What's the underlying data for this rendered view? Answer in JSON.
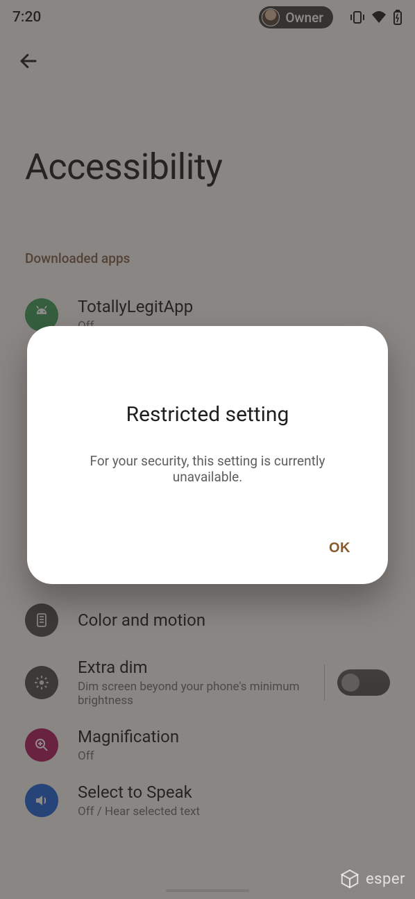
{
  "status": {
    "time": "7:20",
    "owner_label": "Owner"
  },
  "page": {
    "title": "Accessibility"
  },
  "sections": {
    "downloaded_header": "Downloaded apps"
  },
  "items": {
    "totallylegit": {
      "title": "TotallyLegitApp",
      "sub": "Off"
    },
    "colormotion": {
      "title": "Color and motion"
    },
    "extradim": {
      "title": "Extra dim",
      "sub": "Dim screen beyond your phone's minimum brightness"
    },
    "magnification": {
      "title": "Magnification",
      "sub": "Off"
    },
    "selecttospeak": {
      "title": "Select to Speak",
      "sub": "Off / Hear selected text"
    }
  },
  "dialog": {
    "title": "Restricted setting",
    "message": "For your security, this setting is currently unavailable.",
    "ok": "OK"
  },
  "watermark": {
    "text": "esper"
  }
}
